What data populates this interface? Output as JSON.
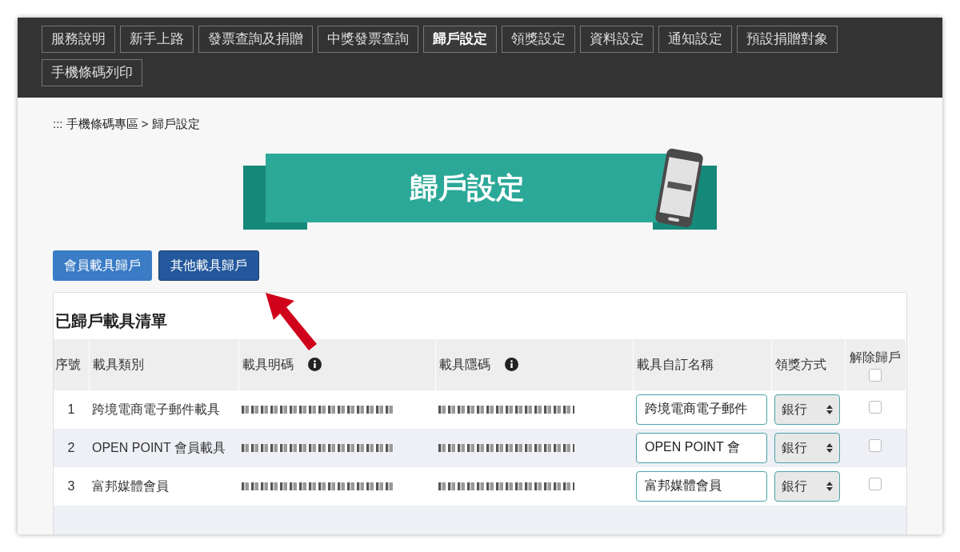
{
  "nav": [
    {
      "label": "服務說明",
      "selected": false
    },
    {
      "label": "新手上路",
      "selected": false
    },
    {
      "label": "發票查詢及捐贈",
      "selected": false
    },
    {
      "label": "中獎發票查詢",
      "selected": false
    },
    {
      "label": "歸戶設定",
      "selected": true
    },
    {
      "label": "領獎設定",
      "selected": false
    },
    {
      "label": "資料設定",
      "selected": false
    },
    {
      "label": "通知設定",
      "selected": false
    },
    {
      "label": "預設捐贈對象",
      "selected": false
    },
    {
      "label": "手機條碼列印",
      "selected": false
    }
  ],
  "breadcrumb": "::: 手機條碼專區 > 歸戶設定",
  "banner_title": "歸戶設定",
  "mode_buttons": [
    {
      "label": "會員載具歸戶",
      "selected": false
    },
    {
      "label": "其他載具歸戶",
      "selected": true
    }
  ],
  "panel": {
    "title": "已歸戶載具清單",
    "columns": [
      {
        "label": "序號",
        "info": false
      },
      {
        "label": "載具類別",
        "info": false
      },
      {
        "label": "載具明碼",
        "info": true
      },
      {
        "label": "載具隱碼",
        "info": true
      },
      {
        "label": "載具自訂名稱",
        "info": false
      },
      {
        "label": "領獎方式",
        "info": false
      },
      {
        "label": "解除歸戶",
        "info": false
      }
    ],
    "select_all_checked": false,
    "rows": [
      {
        "index": "1",
        "type": "跨境電商電子郵件載具",
        "custom_name": "跨境電商電子郵件",
        "method": "銀行",
        "checked": false
      },
      {
        "index": "2",
        "type": "OPEN POINT 會員載具",
        "custom_name": "OPEN POINT 會",
        "method": "銀行",
        "checked": false
      },
      {
        "index": "3",
        "type": "富邦媒體會員",
        "custom_name": "富邦媒體會員",
        "method": "銀行",
        "checked": false
      }
    ]
  }
}
